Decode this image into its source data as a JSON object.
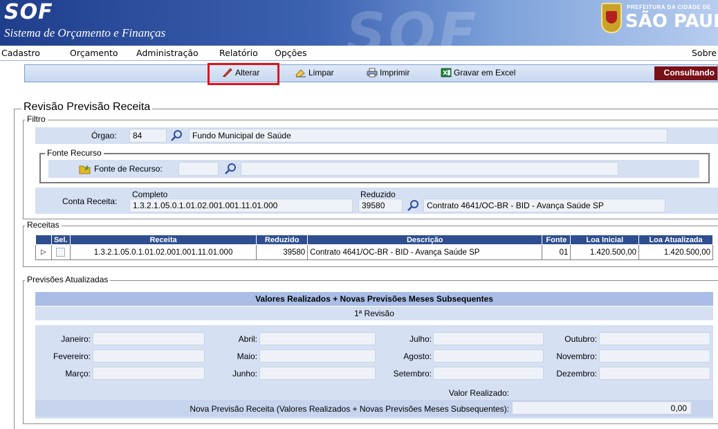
{
  "header": {
    "app_logo": "SOF",
    "app_name": "Sistema de Orçamento e Finanças",
    "watermark": "SOF",
    "city_line1": "PREFEITURA DA CIDADE DE",
    "city_line2": "SÃO PAULO"
  },
  "menu": {
    "items": [
      "Cadastro",
      "Orçamento",
      "Administração",
      "Relatório",
      "Opções"
    ],
    "right": "Sobre"
  },
  "toolbar": {
    "alterar": "Alterar",
    "limpar": "Limpar",
    "imprimir": "Imprimir",
    "gravar_excel": "Gravar em Excel",
    "status": "Consultando"
  },
  "page": {
    "title": "Revisão Previsão Receita"
  },
  "filtro": {
    "legend": "Filtro",
    "orgao_label": "Órgao:",
    "orgao_code": "84",
    "orgao_name": "Fundo Municipal de Saúde",
    "fonte_legend": "Fonte Recurso",
    "fonte_label": "Fonte de Recurso:",
    "fonte_code": "",
    "fonte_name": "",
    "conta_label": "Conta Receita:",
    "completo_label": "Completo",
    "completo_value": "1.3.2.1.05.0.1.01.02.001.001.11.01.000",
    "reduzido_label": "Reduzido",
    "reduzido_value": "39580",
    "reduzido_desc": "Contrato 4641/OC-BR - BID - Avança Saúde SP"
  },
  "receitas": {
    "legend": "Receitas",
    "columns": [
      "Sel.",
      "Receita",
      "Reduzido",
      "Descrição",
      "Fonte",
      "Loa Inicial",
      "Loa Atualizada"
    ],
    "rows": [
      {
        "receita": "1.3.2.1.05.0.1.01.02.001.001.11.01.000",
        "reduzido": "39580",
        "descricao": "Contrato 4641/OC-BR - BID - Avança Saúde SP",
        "fonte": "01",
        "loa_inicial": "1.420.500,00",
        "loa_atualizada": "1.420.500,00"
      }
    ]
  },
  "previsoes": {
    "legend": "Previsões Atualizadas",
    "header": "Valores Realizados + Novas Previsões Meses Subsequentes",
    "revisao": "1ª Revisão",
    "months": {
      "janeiro": "Janeiro:",
      "fevereiro": "Fevereiro:",
      "marco": "Março:",
      "abril": "Abril:",
      "maio": "Maio:",
      "junho": "Junho:",
      "julho": "Julho:",
      "agosto": "Agosto:",
      "setembro": "Setembro:",
      "outubro": "Outubro:",
      "novembro": "Novembro:",
      "dezembro": "Dezembro:"
    },
    "valor_realizado_label": "Valor Realizado:",
    "nova_previsao_label": "Nova Previsão Receita (Valores Realizados + Novas Previsões Meses Subsequentes):",
    "nova_previsao_value": "0,00"
  },
  "colors": {
    "header_blue": "#2e4e8f",
    "panel_blue": "#d5e0f3",
    "status_red": "#7a1017",
    "highlight": "#e0111a"
  }
}
